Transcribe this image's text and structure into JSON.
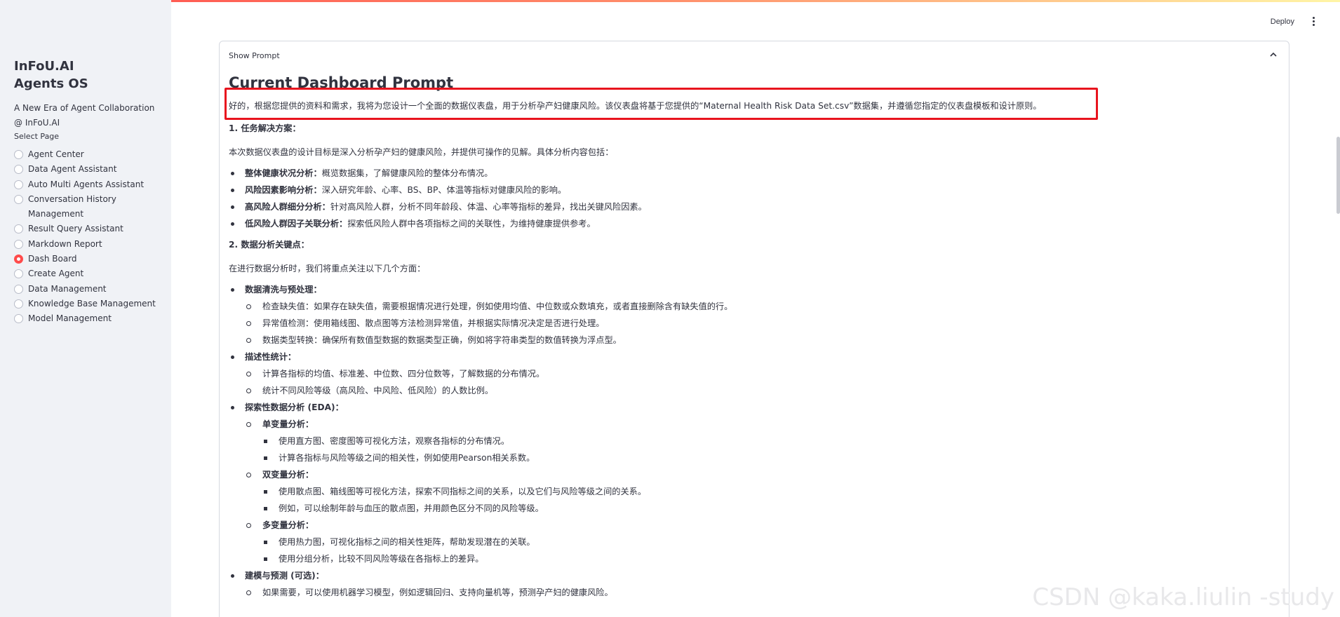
{
  "sidebar": {
    "brand_line1": "InFoU.AI",
    "brand_line2": "Agents OS",
    "tagline": "A New Era of Agent Collaboration @ InFoU.AI",
    "select_label": "Select Page",
    "items": [
      {
        "label": "Agent Center",
        "selected": false
      },
      {
        "label": "Data Agent Assistant",
        "selected": false
      },
      {
        "label": "Auto Multi Agents Assistant",
        "selected": false
      },
      {
        "label": "Conversation History Management",
        "selected": false
      },
      {
        "label": "Result Query Assistant",
        "selected": false
      },
      {
        "label": "Markdown Report",
        "selected": false
      },
      {
        "label": "Dash Board",
        "selected": true
      },
      {
        "label": "Create Agent",
        "selected": false
      },
      {
        "label": "Data Management",
        "selected": false
      },
      {
        "label": "Knowledge Base Management",
        "selected": false
      },
      {
        "label": "Model Management",
        "selected": false
      }
    ]
  },
  "header": {
    "deploy_label": "Deploy",
    "menu_icon": "kebab-menu-icon"
  },
  "expander": {
    "label": "Show Prompt",
    "expanded": true,
    "icon": "chevron-up-icon"
  },
  "prompt": {
    "title": "Current Dashboard Prompt",
    "intro": "好的，根据您提供的资料和需求，我将为您设计一个全面的数据仪表盘，用于分析孕产妇健康风险。该仪表盘将基于您提供的“Maternal Health Risk Data Set.csv”数据集，并遵循您指定的仪表盘模板和设计原则。",
    "s1_title": "1. 任务解决方案：",
    "s1_desc": "本次数据仪表盘的设计目标是深入分析孕产妇的健康风险，并提供可操作的见解。具体分析内容包括：",
    "s1_items": [
      {
        "bold": "整体健康状况分析：",
        "text": "概览数据集，了解健康风险的整体分布情况。"
      },
      {
        "bold": "风险因素影响分析：",
        "text": "深入研究年龄、心率、BS、BP、体温等指标对健康风险的影响。"
      },
      {
        "bold": "高风险人群细分分析：",
        "text": "针对高风险人群，分析不同年龄段、体温、心率等指标的差异，找出关键风险因素。"
      },
      {
        "bold": "低风险人群因子关联分析：",
        "text": "探索低风险人群中各项指标之间的关联性，为维持健康提供参考。"
      }
    ],
    "s2_title": "2. 数据分析关键点：",
    "s2_desc": "在进行数据分析时，我们将重点关注以下几个方面：",
    "cleaning": {
      "title": "数据清洗与预处理：",
      "items": [
        "检查缺失值：如果存在缺失值，需要根据情况进行处理，例如使用均值、中位数或众数填充，或者直接删除含有缺失值的行。",
        "异常值检测：使用箱线图、散点图等方法检测异常值，并根据实际情况决定是否进行处理。",
        "数据类型转换：确保所有数值型数据的数据类型正确，例如将字符串类型的数值转换为浮点型。"
      ]
    },
    "descriptive": {
      "title": "描述性统计：",
      "items": [
        "计算各指标的均值、标准差、中位数、四分位数等，了解数据的分布情况。",
        "统计不同风险等级（高风险、中风险、低风险）的人数比例。"
      ]
    },
    "eda": {
      "title": "探索性数据分析 (EDA)：",
      "univariate": {
        "title": "单变量分析：",
        "items": [
          "使用直方图、密度图等可视化方法，观察各指标的分布情况。",
          "计算各指标与风险等级之间的相关性，例如使用Pearson相关系数。"
        ]
      },
      "bivariate": {
        "title": "双变量分析：",
        "items": [
          "使用散点图、箱线图等可视化方法，探索不同指标之间的关系，以及它们与风险等级之间的关系。",
          "例如，可以绘制年龄与血压的散点图，并用颜色区分不同的风险等级。"
        ]
      },
      "multivariate": {
        "title": "多变量分析：",
        "items": [
          "使用热力图，可视化指标之间的相关性矩阵，帮助发现潜在的关联。",
          "使用分组分析，比较不同风险等级在各指标上的差异。"
        ]
      }
    },
    "modeling": {
      "title": "建模与预测 (可选)：",
      "items": [
        "如果需要，可以使用机器学习模型，例如逻辑回归、支持向量机等，预测孕产妇的健康风险。"
      ]
    }
  },
  "watermark": "CSDN @kaka.liulin -study"
}
